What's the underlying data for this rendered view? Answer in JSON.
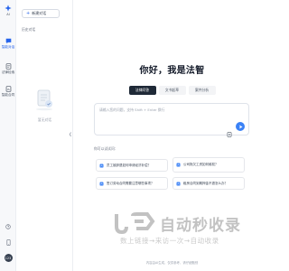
{
  "nav": {
    "items": [
      {
        "label": "AI",
        "icon": "ai-icon"
      },
      {
        "label": "智能对话",
        "icon": "chat-icon"
      },
      {
        "label": "法律检索",
        "icon": "law-search-icon"
      },
      {
        "label": "智能合同",
        "icon": "contract-icon"
      }
    ],
    "avatar_text": "123"
  },
  "sidebar": {
    "new_chat_label": "新建对话",
    "section_heading": "历史对话",
    "empty_text": "暂无对话",
    "collapse_glyph": "❮"
  },
  "main": {
    "greeting": "你好，我是法智",
    "modes": [
      {
        "label": "法律问答",
        "active": true
      },
      {
        "label": "文书起草",
        "active": false
      },
      {
        "label": "案件分析",
        "active": false
      }
    ],
    "input_placeholder": "请输入您的问题，支持 Shift + Enter 换行",
    "examples_title": "你可以试试问：",
    "examples": [
      "员工被辞退如何申请经济补偿？",
      "公司拖欠工资如何维权？",
      "签订劳动合同需要注意哪些事项？",
      "租房合同到期押金不退怎么办？"
    ],
    "footer": "内容由AI生成，仅供参考，请仔细甄别"
  },
  "watermark": {
    "title": "自动秒收录",
    "slogan": "数上链接→来访一次→自动收录"
  },
  "colors": {
    "accent": "#3b82f6",
    "active_mode_bg": "#1f2937",
    "rail_bg": "#f7f8fa"
  }
}
